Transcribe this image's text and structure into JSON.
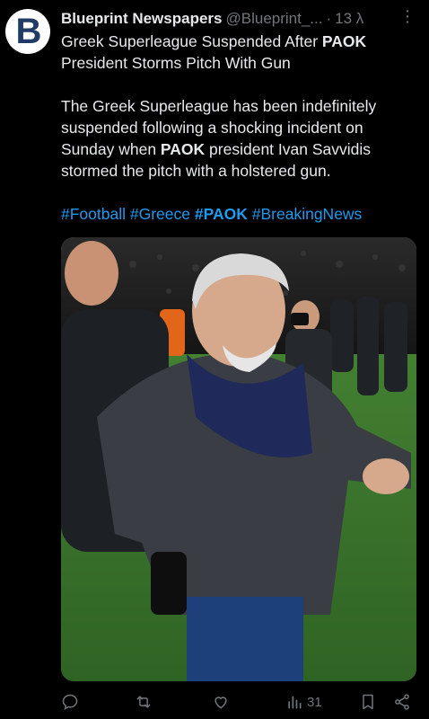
{
  "author": {
    "avatar_letter": "B",
    "name": "Blueprint Newspapers",
    "handle": "@Blueprint_...",
    "separator": "·",
    "time": "13 λ",
    "more": "⋮"
  },
  "tweet": {
    "headline_pre": "Greek Superleague Suspended After ",
    "headline_bold": "PAOK",
    "headline_post": " President Storms Pitch With Gun",
    "para_pre": "The Greek Superleague has been indefinitely suspended following a shocking incident on Sunday when ",
    "para_bold": "PAOK",
    "para_post": " president Ivan Savvidis stormed the pitch with a holstered gun.",
    "hashtags": [
      {
        "text": "#Football",
        "bold": false
      },
      {
        "text": "#Greece",
        "bold": false
      },
      {
        "text": "#PAOK",
        "bold": true
      },
      {
        "text": "#BreakingNews",
        "bold": false
      }
    ]
  },
  "media": {
    "description_colors": {
      "grass": "#3f7a2e",
      "crowd": "#1c1c1c",
      "jacket": "#3a3d44"
    }
  },
  "actions": {
    "views_count": "31",
    "icons": [
      "reply-icon",
      "retweet-icon",
      "like-icon",
      "views-icon",
      "bookmark-icon",
      "share-icon"
    ]
  },
  "colors": {
    "accent": "#1d9bf0",
    "secondary_text": "#71767b",
    "primary_text": "#e7e9ea",
    "background": "#000000"
  }
}
